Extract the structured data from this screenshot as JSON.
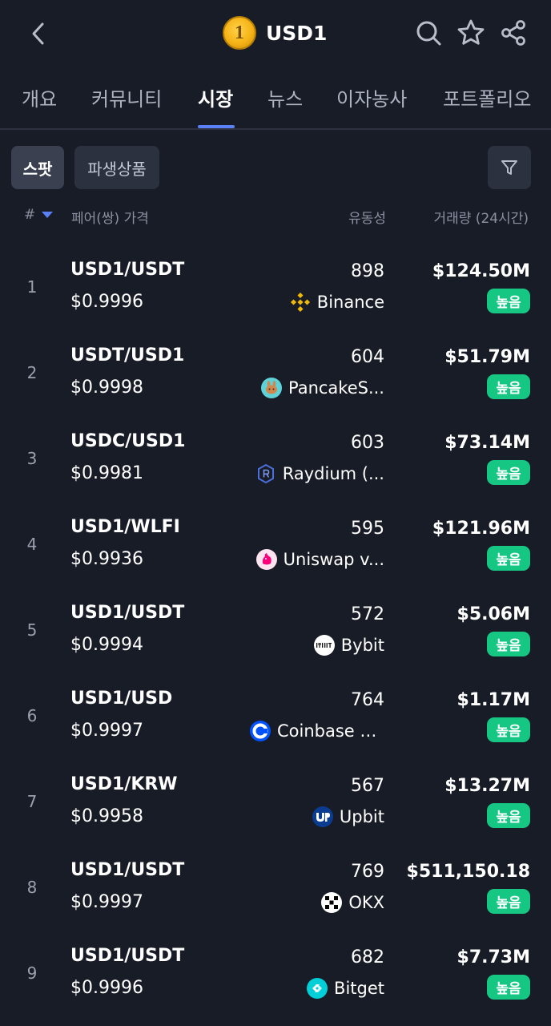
{
  "header": {
    "title": "USD1",
    "coin_symbol": "1",
    "icons": [
      "back-icon",
      "search-icon",
      "star-icon",
      "share-icon"
    ]
  },
  "tabs": [
    {
      "label": "개요"
    },
    {
      "label": "커뮤니티"
    },
    {
      "label": "시장"
    },
    {
      "label": "뉴스"
    },
    {
      "label": "이자농사"
    },
    {
      "label": "포트폴리오"
    }
  ],
  "active_tab": "시장",
  "filters": {
    "spot_label": "스팟",
    "derivatives_label": "파생상품"
  },
  "columns": {
    "rank": "#",
    "pair_price": "페어(쌍) 가격",
    "liquidity": "유동성",
    "volume": "거래량 (24시간)"
  },
  "rows": [
    {
      "rank": "1",
      "pair": "USD1/USDT",
      "price": "$0.9996",
      "liquidity": "898",
      "exchange": "Binance",
      "volume": "$124.50M",
      "badge": "높음"
    },
    {
      "rank": "2",
      "pair": "USDT/USD1",
      "price": "$0.9998",
      "liquidity": "604",
      "exchange": "PancakeS...",
      "volume": "$51.79M",
      "badge": "높음"
    },
    {
      "rank": "3",
      "pair": "USDC/USD1",
      "price": "$0.9981",
      "liquidity": "603",
      "exchange": "Raydium (...",
      "volume": "$73.14M",
      "badge": "높음"
    },
    {
      "rank": "4",
      "pair": "USD1/WLFI",
      "price": "$0.9936",
      "liquidity": "595",
      "exchange": "Uniswap v...",
      "volume": "$121.96M",
      "badge": "높음"
    },
    {
      "rank": "5",
      "pair": "USD1/USDT",
      "price": "$0.9994",
      "liquidity": "572",
      "exchange": "Bybit",
      "volume": "$5.06M",
      "badge": "높음"
    },
    {
      "rank": "6",
      "pair": "USD1/USD",
      "price": "$0.9997",
      "liquidity": "764",
      "exchange": "Coinbase E...",
      "volume": "$1.17M",
      "badge": "높음"
    },
    {
      "rank": "7",
      "pair": "USD1/KRW",
      "price": "$0.9958",
      "liquidity": "567",
      "exchange": "Upbit",
      "volume": "$13.27M",
      "badge": "높음"
    },
    {
      "rank": "8",
      "pair": "USD1/USDT",
      "price": "$0.9997",
      "liquidity": "769",
      "exchange": "OKX",
      "volume": "$511,150.18",
      "badge": "높음"
    },
    {
      "rank": "9",
      "pair": "USD1/USDT",
      "price": "$0.9996",
      "liquidity": "682",
      "exchange": "Bitget",
      "volume": "$7.73M",
      "badge": "높음"
    }
  ],
  "colors": {
    "background": "#181c27",
    "accent": "#5b7ff5",
    "badge_green": "#16c784"
  }
}
